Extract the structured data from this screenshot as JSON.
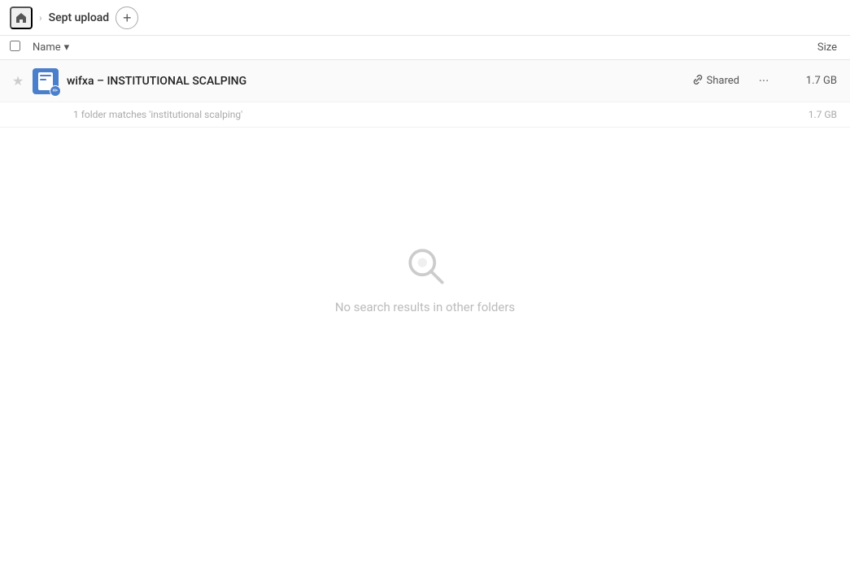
{
  "header": {
    "home_icon": "🏠",
    "breadcrumb_label": "Sept upload",
    "add_icon": "+",
    "chevron": "›"
  },
  "columns": {
    "name_label": "Name",
    "sort_icon": "▾",
    "size_label": "Size"
  },
  "file_row": {
    "name": "wifxa – INSTITUTIONAL SCALPING",
    "shared_label": "Shared",
    "size": "1.7 GB",
    "more_icon": "···",
    "link_icon": "🔗",
    "star_icon": "★"
  },
  "info_row": {
    "matches_text": "1 folder matches 'institutional scalping'",
    "size": "1.7 GB"
  },
  "empty_state": {
    "message": "No search results in other folders"
  }
}
